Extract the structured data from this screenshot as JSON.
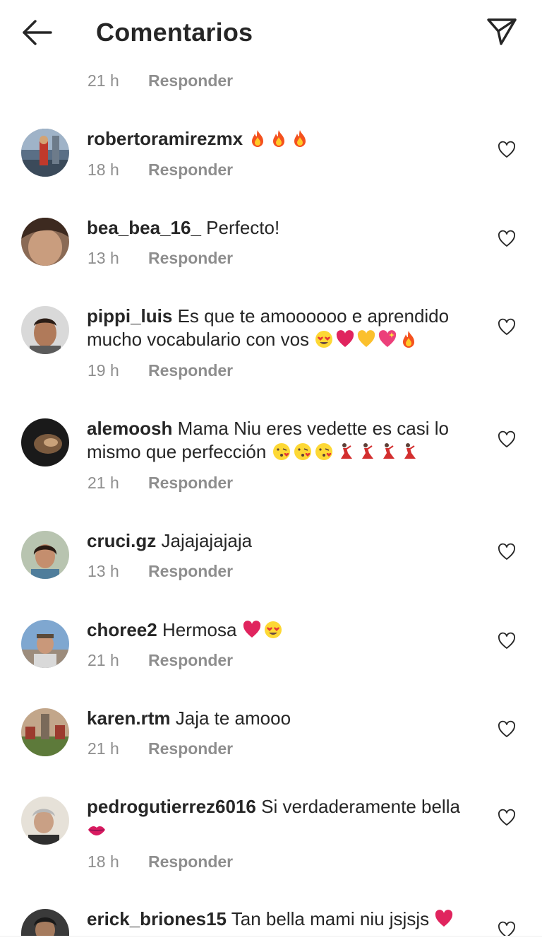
{
  "header": {
    "title": "Comentarios",
    "back_icon": "arrow-left-icon",
    "send_icon": "paper-plane-icon"
  },
  "colors": {
    "text": "#262626",
    "secondary": "#8e8e8e",
    "background": "#ffffff",
    "heart_red": "#e0245e",
    "fire_orange": "#f4511e"
  },
  "orphan_meta": {
    "time": "21 h",
    "reply": "Responder"
  },
  "comments": [
    {
      "username": "robertoramirezmx",
      "text": "",
      "emojis": [
        "fire-icon",
        "fire-icon",
        "fire-icon"
      ],
      "time": "18 h",
      "reply": "Responder"
    },
    {
      "username": "bea_bea_16_",
      "text": "Perfecto!",
      "emojis": [],
      "time": "13 h",
      "reply": "Responder"
    },
    {
      "username": "pippi_luis",
      "text": "Es que te amoooooo e aprendido mucho vocabulario con vos",
      "emojis": [
        "heart-eyes-icon",
        "red-heart-icon",
        "yellow-heart-icon",
        "sparkling-heart-icon",
        "fire-icon"
      ],
      "time": "19 h",
      "reply": "Responder"
    },
    {
      "username": "alemoosh",
      "text": "Mama Niu eres vedette es casi lo mismo que perfección",
      "emojis": [
        "kiss-face-icon",
        "kiss-face-icon",
        "kiss-face-icon",
        "dancer-icon",
        "dancer-icon",
        "dancer-icon",
        "dancer-icon"
      ],
      "time": "21 h",
      "reply": "Responder"
    },
    {
      "username": "cruci.gz",
      "text": "Jajajajajaja",
      "emojis": [],
      "time": "13 h",
      "reply": "Responder"
    },
    {
      "username": "choree2",
      "text": "Hermosa",
      "emojis": [
        "red-heart-icon",
        "heart-eyes-icon"
      ],
      "time": "21 h",
      "reply": "Responder"
    },
    {
      "username": "karen.rtm",
      "text": "Jaja te amooo",
      "emojis": [],
      "time": "21 h",
      "reply": "Responder"
    },
    {
      "username": "pedrogutierrez6016",
      "text": "Si verdaderamente bella",
      "emojis": [
        "lips-icon"
      ],
      "time": "18 h",
      "reply": "Responder"
    },
    {
      "username": "erick_briones15",
      "text": "Tan bella mami niu jsjsjs",
      "emojis": [
        "red-heart-icon"
      ],
      "time": "",
      "reply": ""
    }
  ]
}
